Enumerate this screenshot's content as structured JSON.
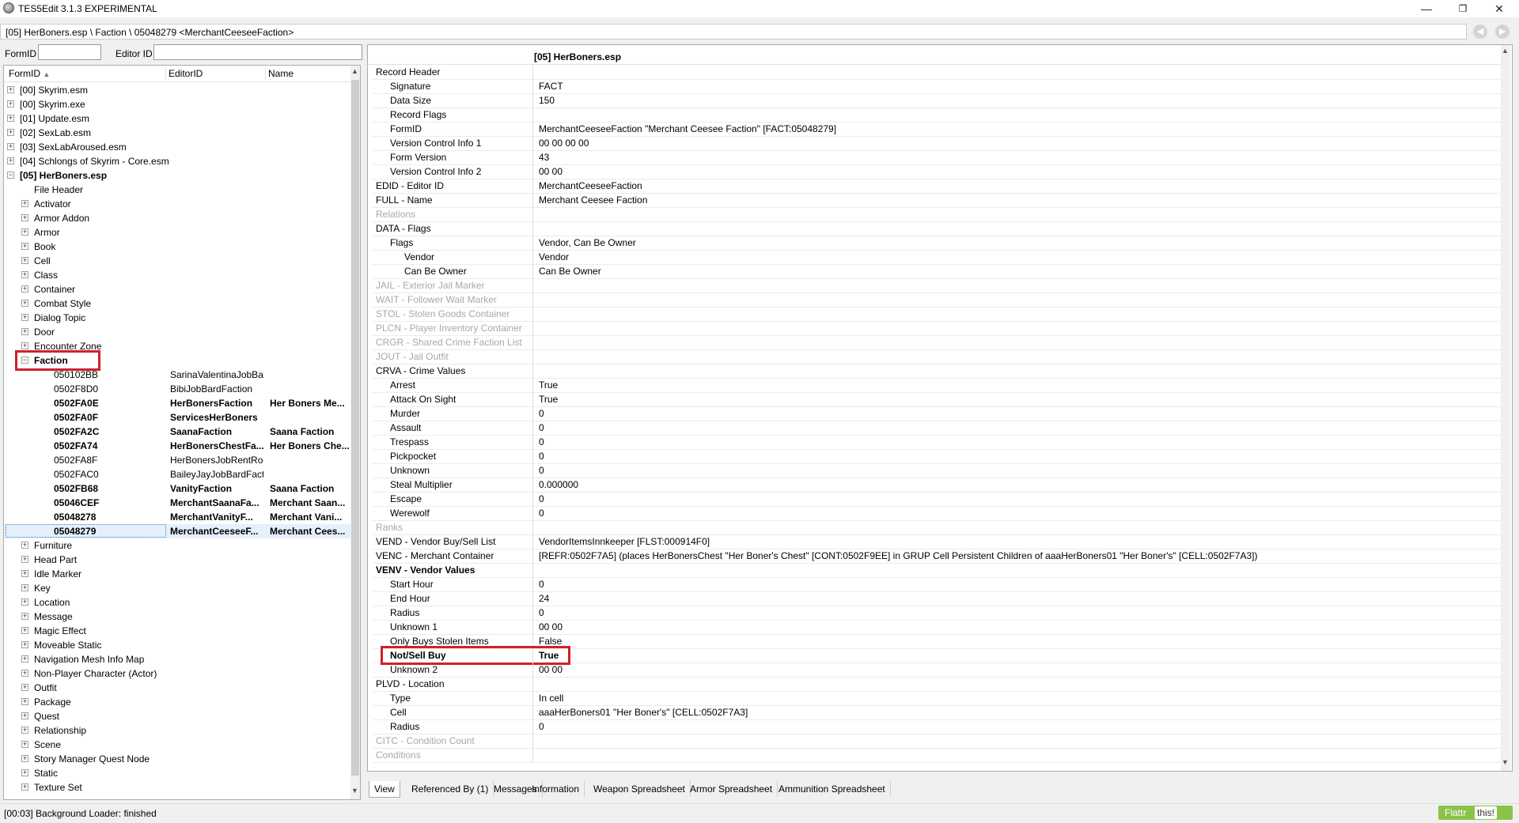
{
  "window": {
    "title": "TES5Edit 3.1.3 EXPERIMENTAL",
    "minimize": "—",
    "restore": "❐",
    "close": "✕"
  },
  "path": "[05] HerBoners.esp \\ Faction \\ 05048279 <MerchantCeeseeFaction>",
  "filter": {
    "formid_label": "FormID",
    "editorid_label": "Editor ID",
    "formid_value": "",
    "editorid_value": ""
  },
  "left_headers": {
    "formid": "FormID",
    "editorid": "EditorID",
    "name": "Name"
  },
  "tree": [
    {
      "level": 0,
      "exp": "+",
      "label": "[00] Skyrim.esm"
    },
    {
      "level": 0,
      "exp": "+",
      "label": "[00] Skyrim.exe"
    },
    {
      "level": 0,
      "exp": "+",
      "label": "[01] Update.esm"
    },
    {
      "level": 0,
      "exp": "+",
      "label": "[02] SexLab.esm"
    },
    {
      "level": 0,
      "exp": "+",
      "label": "[03] SexLabAroused.esm"
    },
    {
      "level": 0,
      "exp": "+",
      "label": "[04] Schlongs of Skyrim - Core.esm"
    },
    {
      "level": 0,
      "exp": "-",
      "label": "[05] HerBoners.esp",
      "bold": true
    },
    {
      "level": 1,
      "exp": "",
      "label": "File Header"
    },
    {
      "level": 1,
      "exp": "+",
      "label": "Activator"
    },
    {
      "level": 1,
      "exp": "+",
      "label": "Armor Addon"
    },
    {
      "level": 1,
      "exp": "+",
      "label": "Armor"
    },
    {
      "level": 1,
      "exp": "+",
      "label": "Book"
    },
    {
      "level": 1,
      "exp": "+",
      "label": "Cell"
    },
    {
      "level": 1,
      "exp": "+",
      "label": "Class"
    },
    {
      "level": 1,
      "exp": "+",
      "label": "Container"
    },
    {
      "level": 1,
      "exp": "+",
      "label": "Combat Style"
    },
    {
      "level": 1,
      "exp": "+",
      "label": "Dialog Topic"
    },
    {
      "level": 1,
      "exp": "+",
      "label": "Door"
    },
    {
      "level": 1,
      "exp": "+",
      "label": "Encounter Zone"
    },
    {
      "level": 1,
      "exp": "-",
      "label": "Faction",
      "bold": true,
      "highlight": true
    },
    {
      "level": 2,
      "exp": "",
      "label": "050102BB",
      "editorid": "SarinaValentinaJobBardFaction",
      "name": ""
    },
    {
      "level": 2,
      "exp": "",
      "label": "0502F8D0",
      "editorid": "BibiJobBardFaction",
      "name": ""
    },
    {
      "level": 2,
      "exp": "",
      "label": "0502FA0E",
      "editorid": "HerBonersFaction",
      "name": "Her Boners Me...",
      "bold": true
    },
    {
      "level": 2,
      "exp": "",
      "label": "0502FA0F",
      "editorid": "ServicesHerBoners",
      "name": "",
      "bold": true
    },
    {
      "level": 2,
      "exp": "",
      "label": "0502FA2C",
      "editorid": "SaanaFaction",
      "name": "Saana Faction",
      "bold": true
    },
    {
      "level": 2,
      "exp": "",
      "label": "0502FA74",
      "editorid": "HerBonersChestFa...",
      "name": "Her Boners Che...",
      "bold": true
    },
    {
      "level": 2,
      "exp": "",
      "label": "0502FA8F",
      "editorid": "HerBonersJobRentRoomFaction",
      "name": ""
    },
    {
      "level": 2,
      "exp": "",
      "label": "0502FAC0",
      "editorid": "BaileyJayJobBardFaction",
      "name": ""
    },
    {
      "level": 2,
      "exp": "",
      "label": "0502FB68",
      "editorid": "VanityFaction",
      "name": "Saana Faction",
      "bold": true
    },
    {
      "level": 2,
      "exp": "",
      "label": "05046CEF",
      "editorid": "MerchantSaanaFa...",
      "name": "Merchant Saan...",
      "bold": true
    },
    {
      "level": 2,
      "exp": "",
      "label": "05048278",
      "editorid": "MerchantVanityF...",
      "name": "Merchant Vani...",
      "bold": true
    },
    {
      "level": 2,
      "exp": "",
      "label": "05048279",
      "editorid": "MerchantCeeseeF...",
      "name": "Merchant Cees...",
      "bold": true,
      "selected": true
    },
    {
      "level": 1,
      "exp": "+",
      "label": "Furniture"
    },
    {
      "level": 1,
      "exp": "+",
      "label": "Head Part"
    },
    {
      "level": 1,
      "exp": "+",
      "label": "Idle Marker"
    },
    {
      "level": 1,
      "exp": "+",
      "label": "Key"
    },
    {
      "level": 1,
      "exp": "+",
      "label": "Location"
    },
    {
      "level": 1,
      "exp": "+",
      "label": "Message"
    },
    {
      "level": 1,
      "exp": "+",
      "label": "Magic Effect"
    },
    {
      "level": 1,
      "exp": "+",
      "label": "Moveable Static"
    },
    {
      "level": 1,
      "exp": "+",
      "label": "Navigation Mesh Info Map"
    },
    {
      "level": 1,
      "exp": "+",
      "label": "Non-Player Character (Actor)"
    },
    {
      "level": 1,
      "exp": "+",
      "label": "Outfit"
    },
    {
      "level": 1,
      "exp": "+",
      "label": "Package"
    },
    {
      "level": 1,
      "exp": "+",
      "label": "Quest"
    },
    {
      "level": 1,
      "exp": "+",
      "label": "Relationship"
    },
    {
      "level": 1,
      "exp": "+",
      "label": "Scene"
    },
    {
      "level": 1,
      "exp": "+",
      "label": "Story Manager Quest Node"
    },
    {
      "level": 1,
      "exp": "+",
      "label": "Static"
    },
    {
      "level": 1,
      "exp": "+",
      "label": "Texture Set"
    }
  ],
  "record": {
    "file": "[05] HerBoners.esp",
    "rows": [
      {
        "level": 0,
        "label": "Record Header",
        "value": ""
      },
      {
        "level": 1,
        "label": "Signature",
        "value": "FACT"
      },
      {
        "level": 1,
        "label": "Data Size",
        "value": "150"
      },
      {
        "level": 1,
        "label": "Record Flags",
        "value": ""
      },
      {
        "level": 1,
        "label": "FormID",
        "value": "MerchantCeeseeFaction \"Merchant Ceesee Faction\" [FACT:05048279]"
      },
      {
        "level": 1,
        "label": "Version Control Info 1",
        "value": "00 00 00 00"
      },
      {
        "level": 1,
        "label": "Form Version",
        "value": "43"
      },
      {
        "level": 1,
        "label": "Version Control Info 2",
        "value": "00 00"
      },
      {
        "level": 0,
        "label": "EDID - Editor ID",
        "value": "MerchantCeeseeFaction"
      },
      {
        "level": 0,
        "label": "FULL - Name",
        "value": "Merchant Ceesee Faction"
      },
      {
        "level": 0,
        "label": "Relations",
        "value": "",
        "gray": true
      },
      {
        "level": 0,
        "label": "DATA - Flags",
        "value": ""
      },
      {
        "level": 1,
        "label": "Flags",
        "value": "Vendor, Can Be Owner"
      },
      {
        "level": 2,
        "label": "Vendor",
        "value": "Vendor"
      },
      {
        "level": 2,
        "label": "Can Be Owner",
        "value": "Can Be Owner"
      },
      {
        "level": 0,
        "label": "JAIL - Exterior Jail Marker",
        "value": "",
        "gray": true
      },
      {
        "level": 0,
        "label": "WAIT - Follower Wait Marker",
        "value": "",
        "gray": true
      },
      {
        "level": 0,
        "label": "STOL - Stolen Goods Container",
        "value": "",
        "gray": true
      },
      {
        "level": 0,
        "label": "PLCN - Player Inventory Container",
        "value": "",
        "gray": true
      },
      {
        "level": 0,
        "label": "CRGR - Shared Crime Faction List",
        "value": "",
        "gray": true
      },
      {
        "level": 0,
        "label": "JOUT - Jail Outfit",
        "value": "",
        "gray": true
      },
      {
        "level": 0,
        "label": "CRVA - Crime Values",
        "value": ""
      },
      {
        "level": 1,
        "label": "Arrest",
        "value": "True"
      },
      {
        "level": 1,
        "label": "Attack On Sight",
        "value": "True"
      },
      {
        "level": 1,
        "label": "Murder",
        "value": "0"
      },
      {
        "level": 1,
        "label": "Assault",
        "value": "0"
      },
      {
        "level": 1,
        "label": "Trespass",
        "value": "0"
      },
      {
        "level": 1,
        "label": "Pickpocket",
        "value": "0"
      },
      {
        "level": 1,
        "label": "Unknown",
        "value": "0"
      },
      {
        "level": 1,
        "label": "Steal Multiplier",
        "value": "0.000000"
      },
      {
        "level": 1,
        "label": "Escape",
        "value": "0"
      },
      {
        "level": 1,
        "label": "Werewolf",
        "value": "0"
      },
      {
        "level": 0,
        "label": "Ranks",
        "value": "",
        "gray": true
      },
      {
        "level": 0,
        "label": "VEND - Vendor Buy/Sell List",
        "value": "VendorItemsInnkeeper [FLST:000914F0]"
      },
      {
        "level": 0,
        "label": "VENC - Merchant Container",
        "value": "[REFR:0502F7A5] (places HerBonersChest \"Her Boner's Chest\" [CONT:0502F9EE] in GRUP Cell Persistent Children of aaaHerBoners01 \"Her Boner's\" [CELL:0502F7A3])"
      },
      {
        "level": 0,
        "label": "VENV - Vendor Values",
        "value": "",
        "bold": true
      },
      {
        "level": 1,
        "label": "Start Hour",
        "value": "0"
      },
      {
        "level": 1,
        "label": "End Hour",
        "value": "24"
      },
      {
        "level": 1,
        "label": "Radius",
        "value": "0"
      },
      {
        "level": 1,
        "label": "Unknown 1",
        "value": "00 00"
      },
      {
        "level": 1,
        "label": "Only Buys Stolen Items",
        "value": "False"
      },
      {
        "level": 1,
        "label": "Not/Sell Buy",
        "value": "True",
        "bold": true,
        "highlight": true
      },
      {
        "level": 1,
        "label": "Unknown 2",
        "value": "00 00"
      },
      {
        "level": 0,
        "label": "PLVD - Location",
        "value": ""
      },
      {
        "level": 1,
        "label": "Type",
        "value": "In cell"
      },
      {
        "level": 1,
        "label": "Cell",
        "value": "aaaHerBoners01 \"Her Boner's\" [CELL:0502F7A3]"
      },
      {
        "level": 1,
        "label": "Radius",
        "value": "0"
      },
      {
        "level": 0,
        "label": "CITC - Condition Count",
        "value": "",
        "gray": true
      },
      {
        "level": 0,
        "label": "Conditions",
        "value": "",
        "gray": true
      }
    ]
  },
  "tabs": [
    "View",
    "Referenced By (1)",
    "Messages",
    "Information",
    "Weapon Spreadsheet",
    "Armor Spreadsheet",
    "Ammunition Spreadsheet"
  ],
  "status": "[00:03] Background Loader: finished",
  "flattr": {
    "label": "Flattr",
    "this": "this!"
  },
  "colors": {
    "highlight": "#d0202a",
    "selection": "#e5f0fb",
    "flattr": "#8bc34a",
    "disabled_text": "#a8a8a8"
  }
}
